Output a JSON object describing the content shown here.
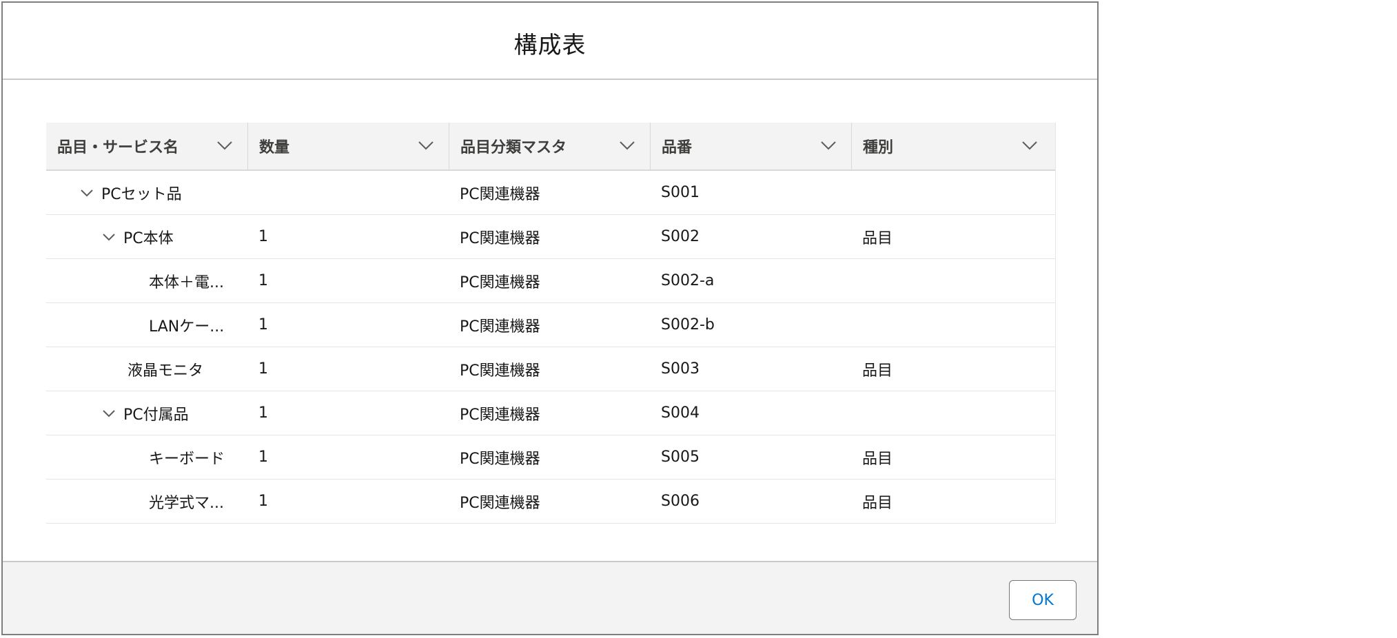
{
  "dialog": {
    "title": "構成表",
    "ok_label": "OK"
  },
  "columns": [
    {
      "label": "品目・サービス名"
    },
    {
      "label": "数量"
    },
    {
      "label": "品目分類マスタ"
    },
    {
      "label": "品番"
    },
    {
      "label": "種別"
    }
  ],
  "rows": [
    {
      "name": "PCセット品",
      "expanded": true,
      "level": 1,
      "qty": "",
      "category": "PC関連機器",
      "code": "S001",
      "type": ""
    },
    {
      "name": "PC本体",
      "expanded": true,
      "level": 2,
      "qty": "1",
      "category": "PC関連機器",
      "code": "S002",
      "type": "品目"
    },
    {
      "name": "本体＋電...",
      "expanded": false,
      "level": 3,
      "qty": "1",
      "category": "PC関連機器",
      "code": "S002-a",
      "type": ""
    },
    {
      "name": "LANケー...",
      "expanded": false,
      "level": 3,
      "qty": "1",
      "category": "PC関連機器",
      "code": "S002-b",
      "type": ""
    },
    {
      "name": "液晶モニタ",
      "expanded": false,
      "level": 2,
      "qty": "1",
      "category": "PC関連機器",
      "code": "S003",
      "type": "品目"
    },
    {
      "name": "PC付属品",
      "expanded": true,
      "level": 2,
      "qty": "1",
      "category": "PC関連機器",
      "code": "S004",
      "type": ""
    },
    {
      "name": "キーボード",
      "expanded": false,
      "level": 3,
      "qty": "1",
      "category": "PC関連機器",
      "code": "S005",
      "type": "品目"
    },
    {
      "name": "光学式マ...",
      "expanded": false,
      "level": 3,
      "qty": "1",
      "category": "PC関連機器",
      "code": "S006",
      "type": "品目"
    }
  ]
}
